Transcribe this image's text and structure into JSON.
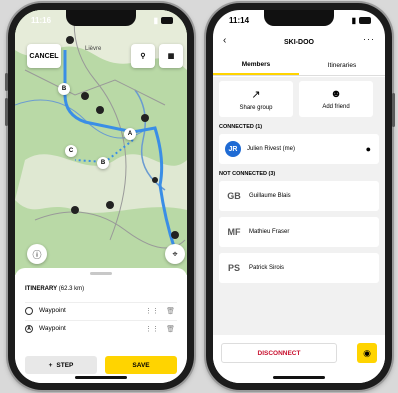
{
  "left_phone": {
    "status": {
      "time": "11:16"
    },
    "map": {
      "cancel_label": "CANCEL",
      "place_label": "Lièvre",
      "waypoint_labels": [
        "B",
        "A",
        "C",
        "B"
      ]
    },
    "sheet": {
      "itinerary_label": "ITINERARY",
      "distance": "(62.3 km)",
      "waypoints": [
        {
          "marker": "",
          "label": "Waypoint"
        },
        {
          "marker": "A",
          "label": "Waypoint"
        }
      ],
      "step_label": "STEP",
      "save_label": "SAVE"
    }
  },
  "right_phone": {
    "status": {
      "time": "11:14"
    },
    "header": {
      "title": "SKI-DOO"
    },
    "tabs": [
      {
        "label": "Members"
      },
      {
        "label": "Itineraries"
      }
    ],
    "actions": {
      "share_label": "Share group",
      "add_label": "Add friend"
    },
    "connected": {
      "title": "CONNECTED (1)",
      "members": [
        {
          "initials": "JR",
          "name": "Julien Rivest (me)"
        }
      ]
    },
    "not_connected": {
      "title": "NOT CONNECTED (3)",
      "members": [
        {
          "initials": "GB",
          "name": "Guillaume Blais"
        },
        {
          "initials": "MF",
          "name": "Mathieu Fraser"
        },
        {
          "initials": "PS",
          "name": "Patrick Sirois"
        }
      ]
    },
    "footer": {
      "disconnect_label": "DISCONNECT"
    }
  },
  "colors": {
    "accent": "#ffd400",
    "route": "#3a8ee6",
    "danger": "#c8102e",
    "avatar": "#1f6bd4",
    "map": "#b9d9a6"
  }
}
